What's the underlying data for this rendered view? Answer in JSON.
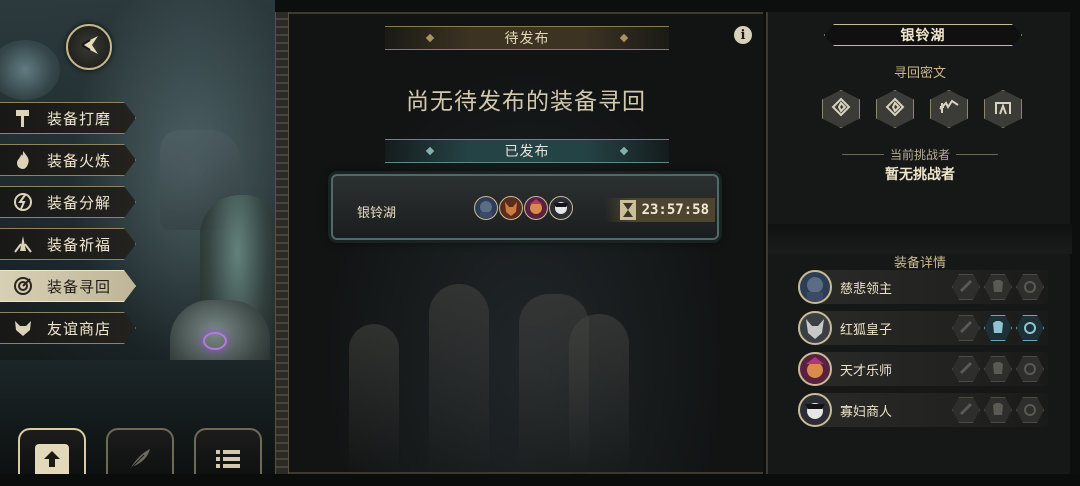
{
  "left_menu": {
    "items": [
      {
        "label": "装备打磨",
        "icon": "hammer-icon",
        "active": false
      },
      {
        "label": "装备火炼",
        "icon": "flame-icon",
        "active": false
      },
      {
        "label": "装备分解",
        "icon": "dismantle-icon",
        "active": false
      },
      {
        "label": "装备祈福",
        "icon": "prayer-icon",
        "active": false
      },
      {
        "label": "装备寻回",
        "icon": "retrieve-icon",
        "active": true
      },
      {
        "label": "友谊商店",
        "icon": "fox-shop-icon",
        "active": false
      }
    ],
    "back_icon": "back-arrow-icon",
    "bottom_buttons": [
      {
        "icon": "upload-icon",
        "active": true
      },
      {
        "icon": "feather-icon",
        "active": false
      },
      {
        "icon": "list-icon",
        "active": false
      }
    ]
  },
  "center": {
    "pending_header": "待发布",
    "empty_message": "尚无待发布的装备寻回",
    "published_header": "已发布",
    "info_icon": "i",
    "published_card": {
      "name": "银铃湖",
      "portraits": [
        "merciful-lord-portrait",
        "red-fox-prince-portrait",
        "genius-musician-portrait",
        "widow-merchant-portrait"
      ],
      "timer": "23:57:58"
    }
  },
  "right": {
    "title": "银铃湖",
    "cipher_label": "寻回密文",
    "runes": [
      "rune-1",
      "rune-2",
      "rune-3",
      "rune-4"
    ],
    "challenger_label": "当前挑战者",
    "challenger_value": "暂无挑战者",
    "equip_label": "装备详情",
    "equipment": [
      {
        "name": "慈悲领主",
        "slots": [
          false,
          false,
          false
        ]
      },
      {
        "name": "红狐皇子",
        "slots": [
          false,
          true,
          true
        ]
      },
      {
        "name": "天才乐师",
        "slots": [
          false,
          false,
          false
        ]
      },
      {
        "name": "寡妇商人",
        "slots": [
          false,
          false,
          false
        ]
      }
    ]
  },
  "colors": {
    "accent_gold": "#c7bb92",
    "teal": "#5f8a86",
    "active_slot": "#6ea5b5"
  }
}
